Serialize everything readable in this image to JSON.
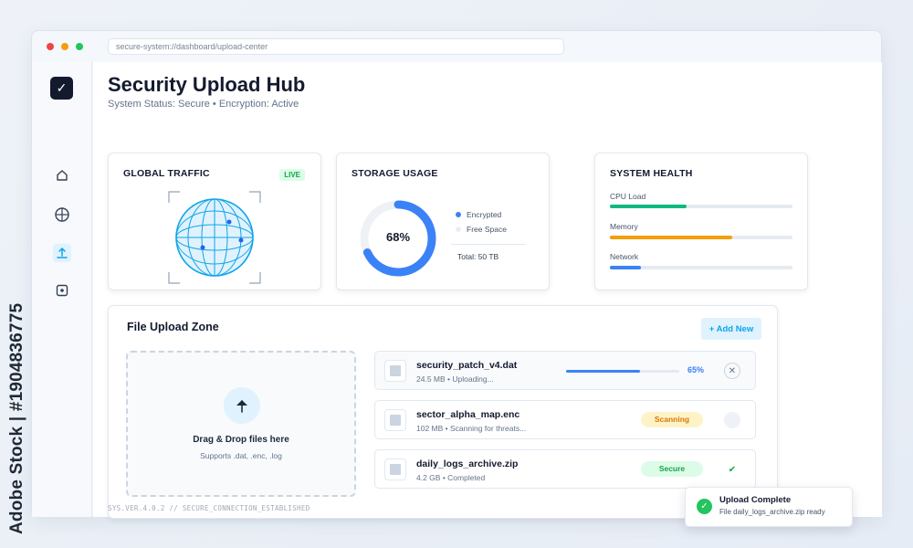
{
  "stock_label": "Adobe Stock | #1904836775",
  "browser": {
    "url": "secure-system://dashboard/upload-center"
  },
  "sidebar": {
    "logo_glyph": "✓",
    "items": [
      {
        "icon": "home-icon"
      },
      {
        "icon": "globe-icon"
      },
      {
        "icon": "upload-icon",
        "active": true
      },
      {
        "icon": "settings-icon"
      }
    ]
  },
  "header": {
    "title": "Security Upload Hub",
    "subtitle": "System Status: Secure • Encryption: Active"
  },
  "traffic": {
    "title": "GLOBAL TRAFFIC",
    "badge": "LIVE"
  },
  "storage": {
    "title": "STORAGE USAGE",
    "percent_label": "68%",
    "used_fraction": 0.68,
    "legend": [
      {
        "label": "Encrypted",
        "color": "#3b82f6"
      },
      {
        "label": "Free Space",
        "color": "#e8eef7"
      }
    ],
    "total": "Total: 50 TB"
  },
  "health": {
    "title": "SYSTEM HEALTH",
    "metrics": [
      {
        "label": "CPU Load",
        "level": 0.42,
        "color": "#10b981"
      },
      {
        "label": "Memory",
        "level": 0.67,
        "color": "#f59e0b"
      },
      {
        "label": "Network",
        "level": 0.17,
        "color": "#3b82f6"
      }
    ]
  },
  "upload": {
    "title": "File Upload Zone",
    "add_button": "+ Add New",
    "dropzone": {
      "title": "Drag & Drop files here",
      "subtitle": "Supports .dat, .enc, .log"
    },
    "files": [
      {
        "name": "security_patch_v4.dat",
        "meta": "24.5 MB • Uploading...",
        "progress": 0.65,
        "progress_label": "65%",
        "action_icon": "close-icon"
      },
      {
        "name": "sector_alpha_map.enc",
        "meta": "102 MB • Scanning for threats...",
        "status": "Scanning",
        "status_bg": "#fef3c7",
        "status_color": "#d97706"
      },
      {
        "name": "daily_logs_archive.zip",
        "meta": "4.2 GB • Completed",
        "status": "Secure",
        "status_bg": "#dcfce7",
        "status_color": "#16a34a",
        "action_icon": "check-icon"
      }
    ]
  },
  "footer": {
    "text": "SYS.VER.4.0.2 // SECURE_CONNECTION_ESTABLISHED"
  },
  "toast": {
    "title": "Upload Complete",
    "message": "File daily_logs_archive.zip ready"
  }
}
